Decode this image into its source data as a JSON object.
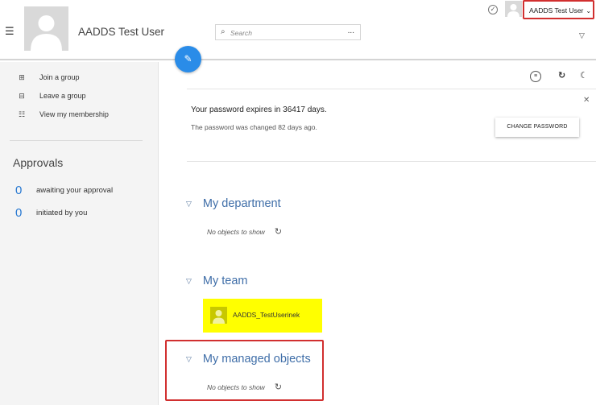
{
  "header": {
    "user_title": "AADDS Test User",
    "search_placeholder": "Search",
    "search_more": "...",
    "user_menu_label": "AADDS Test User"
  },
  "sidebar": {
    "links": [
      {
        "label": "Join a group",
        "icon": "join-group-icon"
      },
      {
        "label": "Leave a group",
        "icon": "leave-group-icon"
      },
      {
        "label": "View my membership",
        "icon": "membership-icon"
      }
    ],
    "approvals": {
      "title": "Approvals",
      "awaiting_count": "0",
      "awaiting_label": "awaiting your approval",
      "initiated_count": "0",
      "initiated_label": "initiated by you"
    }
  },
  "password_notice": {
    "title": "Your password expires in 36417 days.",
    "subtitle": "The password was changed 82 days ago.",
    "button_label": "CHANGE PASSWORD"
  },
  "sections": {
    "department": {
      "title": "My department",
      "empty_text": "No objects to show"
    },
    "team": {
      "title": "My team",
      "member_name": "AADDS_TestUserinek"
    },
    "managed": {
      "title": "My managed objects",
      "empty_text": "No objects to show"
    }
  },
  "colors": {
    "accent_blue": "#2a8ce8",
    "section_blue": "#3f6ea8",
    "highlight_yellow": "#ffff00",
    "annotation_red": "#d12f2f"
  }
}
